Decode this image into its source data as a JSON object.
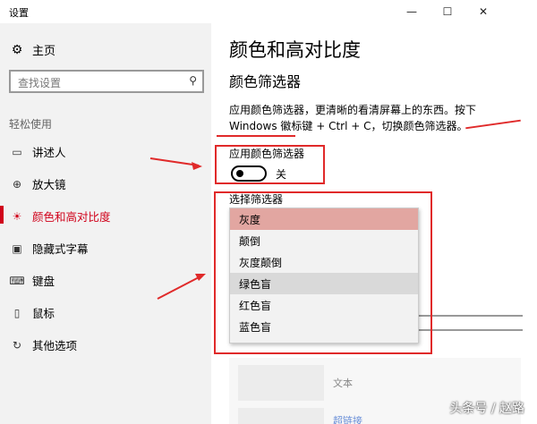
{
  "window": {
    "title": "设置",
    "minimize_icon": "—",
    "maximize_icon": "☐",
    "close_icon": "✕"
  },
  "sidebar": {
    "home_label": "主页",
    "search_placeholder": "查找设置",
    "section_label": "轻松使用",
    "items": [
      {
        "label": "讲述人",
        "icon": "narrator-icon"
      },
      {
        "label": "放大镜",
        "icon": "magnifier-icon"
      },
      {
        "label": "颜色和高对比度",
        "icon": "color-contrast-icon",
        "active": true
      },
      {
        "label": "隐藏式字幕",
        "icon": "closed-captions-icon"
      },
      {
        "label": "键盘",
        "icon": "keyboard-icon"
      },
      {
        "label": "鼠标",
        "icon": "mouse-icon"
      },
      {
        "label": "其他选项",
        "icon": "other-options-icon"
      }
    ]
  },
  "main": {
    "title": "颜色和高对比度",
    "subtitle": "颜色筛选器",
    "description": "应用颜色筛选器，更清晰的看清屏幕上的东西。按下 Windows 徽标键 + Ctrl + C，切换颜色筛选器。",
    "toggle_label": "应用颜色筛选器",
    "toggle_state": "关",
    "filter_label": "选择筛选器",
    "filter_options": [
      "灰度",
      "颠倒",
      "灰度颠倒",
      "绿色盲",
      "红色盲",
      "蓝色盲"
    ],
    "selected_filter": "灰度",
    "preview_text": "文本",
    "preview_link": "超链接"
  },
  "watermark": "头条号 / 赵路",
  "colors": {
    "accent": "#d0021b",
    "selected_bg": "#e2a6a1",
    "annotation_red": "#e02a2a"
  }
}
